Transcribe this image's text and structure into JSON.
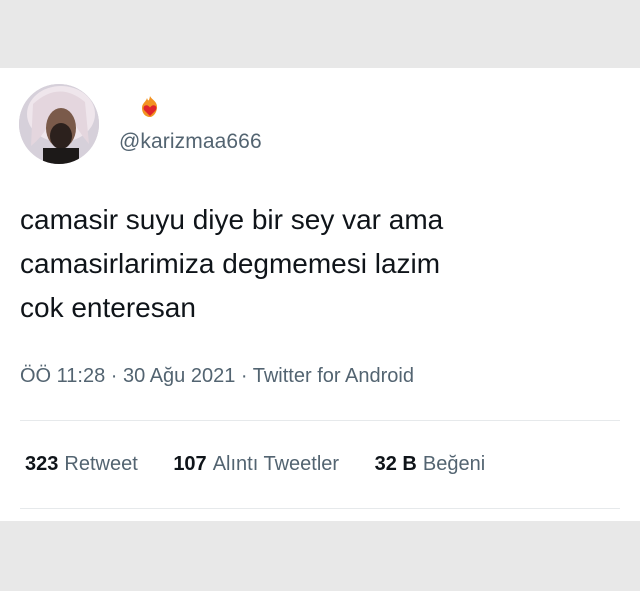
{
  "tweet": {
    "handle": "@karizmaa666",
    "display_name_icon": "fire-heart-emoji",
    "text_lines": [
      "camasir suyu diye bir sey var ama",
      "camasirlarimiza degmemesi lazim",
      "cok enteresan"
    ],
    "meta": "ÖÖ 11:28 · 30 Ağu 2021 · Twitter for Android"
  },
  "stats": [
    {
      "count": "323",
      "label": "Retweet"
    },
    {
      "count": "107",
      "label": "Alıntı Tweetler"
    },
    {
      "count": "32 B",
      "label": "Beğeni"
    }
  ],
  "colors": {
    "text_primary": "#0f1419",
    "text_secondary": "#536471",
    "background": "#e8e8e8",
    "card": "#ffffff"
  }
}
